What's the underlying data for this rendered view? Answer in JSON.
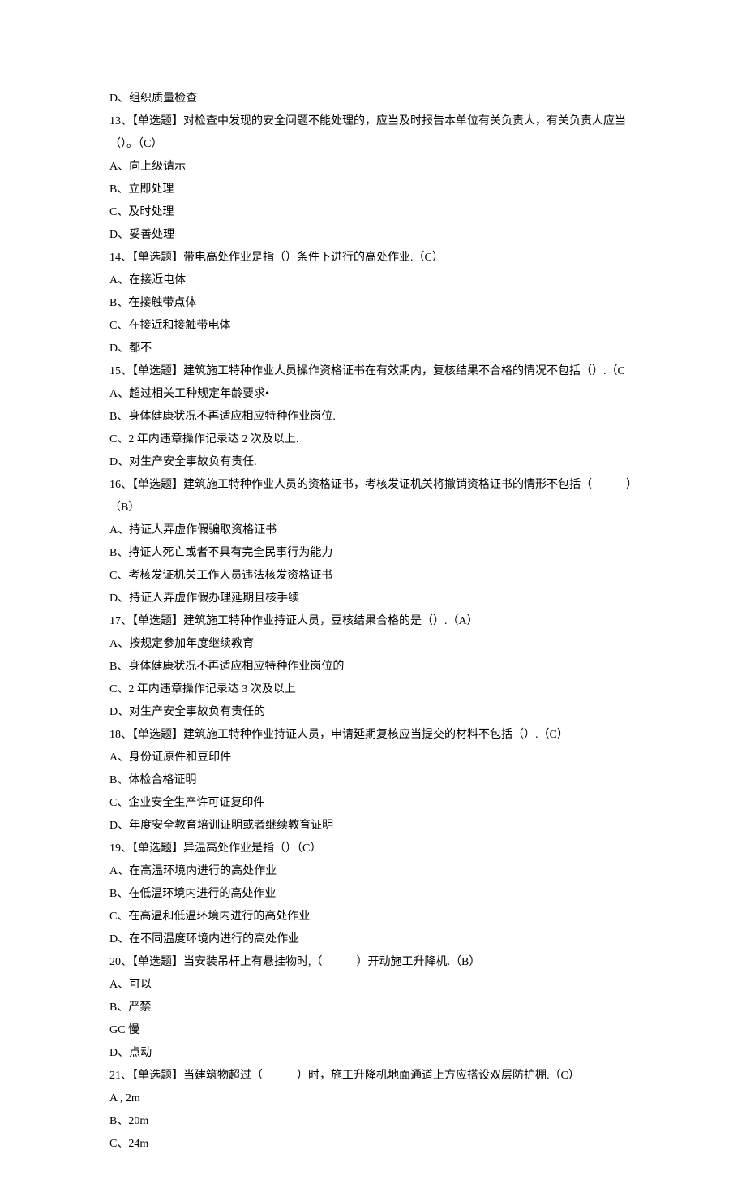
{
  "lines": [
    "D、组织质量检查",
    "13、【单选题】对检查中发现的安全问题不能处理的，应当及时报告本单位有关负责人，有关负责人应当（）。（C）",
    "A、向上级请示",
    "B、立即处理",
    "C、及时处理",
    "D、妥善处理",
    "14、【单选题】带电高处作业是指（）条件下进行的高处作业.（C）",
    "A、在接近电体",
    "B、在接触带点体",
    "C、在接近和接触带电体",
    "D、都不",
    "15、【单选题】建筑施工特种作业人员操作资格证书在有效期内，复核结果不合格的情况不包括（）.（C",
    "A、超过相关工种规定年龄要求•",
    "B、身体健康状况不再适应相应特种作业岗位.",
    "C、2 年内违章操作记录达 2 次及以上.",
    "D、对生产安全事故负有责任.",
    "16、【单选题】建筑施工特种作业人员的资格证书，考核发证机关将撤销资格证书的情形不包括（　　　）（B）",
    "A、持证人弄虚作假骗取资格证书",
    "B、持证人死亡或者不具有完全民事行为能力",
    "C、考核发证机关工作人员违法核发资格证书",
    "D、持证人弄虚作假办理延期且核手续",
    "17、【单选题】建筑施工特种作业持证人员，豆核结果合格的是（）.（A）",
    "A、按规定参加年度继续教育",
    "B、身体健康状况不再适应相应特种作业岗位的",
    "C、2 年内违章操作记录达 3 次及以上",
    "D、对生产安全事故负有责任的",
    "18、【单选题】建筑施工特种作业持证人员，申请延期复核应当提交的材料不包括（）.（C）",
    "A、身份证原件和豆印件",
    "B、体检合格证明",
    "C、企业安全生产许可证复印件",
    "D、年度安全教育培训证明或者继续教育证明",
    "19、【单选题】异温高处作业是指（）（C）",
    "A、在高温环境内进行的高处作业",
    "B、在低温环境内进行的高处作业",
    "C、在高温和低温环境内进行的高处作业",
    "D、在不同温度环境内进行的高处作业",
    "20、【单选题】当安装吊杆上有悬挂物时,（　　　）开动施工升降机.（B）",
    "A、可以",
    "B、严禁",
    "GC 慢",
    "D、点动",
    "21、【单选题】当建筑物超过（　　　）时，施工升降机地面通道上方应搭设双层防护棚.（C）",
    "A ,  2m",
    "B、20m",
    "C、24m"
  ]
}
